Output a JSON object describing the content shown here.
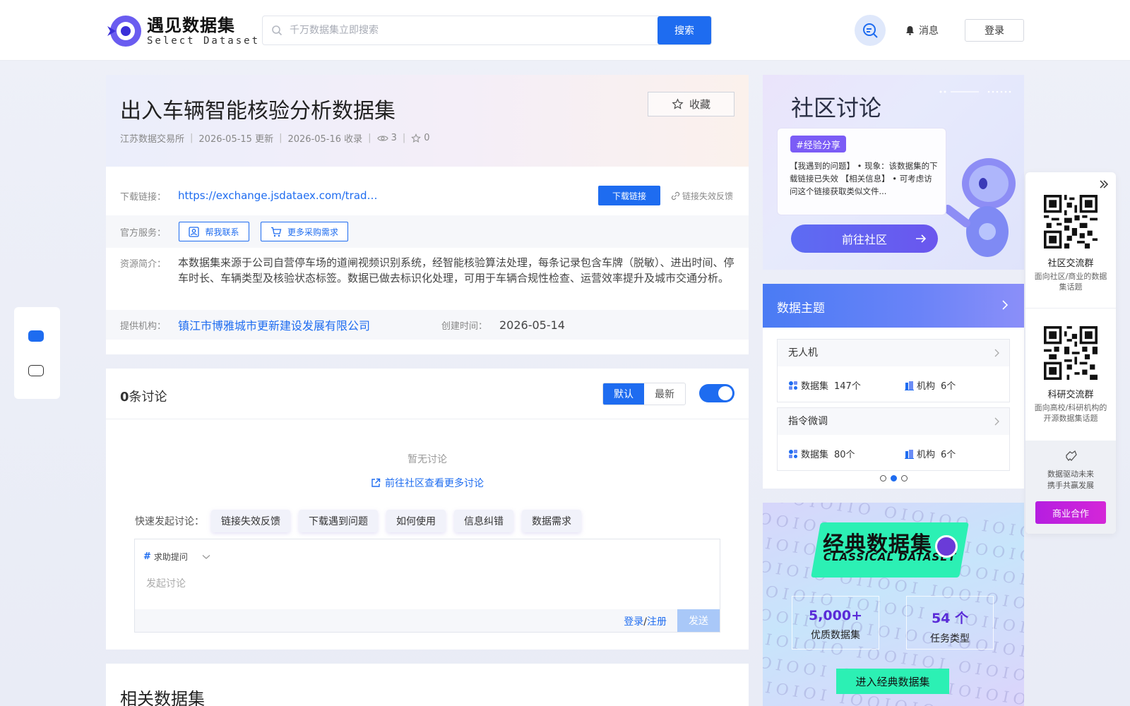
{
  "header": {
    "logo_cn": "遇见数据集",
    "logo_en": "Select Dataset",
    "search_placeholder": "千万数据集立即搜索",
    "search_button": "搜索",
    "messages": "消息",
    "login": "登录"
  },
  "dataset": {
    "title": "出入车辆智能核验分析数据集",
    "favorite_label": "收藏",
    "source": "江苏数据交易所",
    "updated": "2026-05-15 更新",
    "collected": "2026-05-16 收录",
    "views": "3",
    "favorites": "0",
    "download_label": "下载链接：",
    "download_url": "https://exchange.jsdataex.com/trade-…",
    "download_button": "下载链接",
    "link_feedback": "链接失效反馈",
    "service_label": "官方服务：",
    "service_contact": "帮我联系",
    "service_purchase": "更多采购需求",
    "intro_label": "资源简介：",
    "intro_text": "本数据集来源于公司自营停车场的道闸视频识别系统，经智能核验算法处理，每条记录包含车牌（脱敏）、进出时间、停车时长、车辆类型及核验状态标签。数据已做去标识化处理，可用于车辆合规性检查、运营效率提升及城市交通分析。",
    "provider_label": "提供机构：",
    "provider": "镇江市博雅城市更新建设发展有限公司",
    "created_label": "创建时间：",
    "created": "2026-05-14"
  },
  "discussion": {
    "count": "0",
    "count_suffix": "条讨论",
    "sort_default": "默认",
    "sort_latest": "最新",
    "toggle_on": true,
    "empty": "暂无讨论",
    "goto_community": "前往社区查看更多讨论",
    "quick_label": "快速发起讨论：",
    "quick_chips": [
      "链接失效反馈",
      "下载遇到问题",
      "如何使用",
      "信息纠错",
      "数据需求"
    ],
    "editor_tag": "求助提问",
    "editor_placeholder": "发起讨论",
    "login": "登录",
    "slash": "/",
    "register": "注册",
    "send": "发送"
  },
  "related": {
    "title": "相关数据集"
  },
  "community": {
    "title": "社区讨论",
    "tag": "#经验分享",
    "text": "【我遇到的问题】 • 现象：该数据集的下载链接已失效 【相关信息】 • 可考虑访问这个链接获取类似文件...",
    "button": "前往社区"
  },
  "themes": {
    "title": "数据主题",
    "dataset_label": "数据集",
    "org_label": "机构",
    "items": [
      {
        "name": "无人机",
        "datasets": "147个",
        "orgs": "6个"
      },
      {
        "name": "指令微调",
        "datasets": "80个",
        "orgs": "6个"
      }
    ],
    "page": 2,
    "pages": 3
  },
  "classic": {
    "title_cn": "经典数据集",
    "title_en": "CLASSICAL DATASET",
    "stat1_num": "5,000+",
    "stat1_label": "优质数据集",
    "stat2_num": "54 个",
    "stat2_label": "任务类型",
    "button": "进入经典数据集"
  },
  "side_panel": {
    "group1_title": "社区交流群",
    "group1_desc": "面向社区/商业的数据集话题",
    "group2_title": "科研交流群",
    "group2_desc": "面向高校/科研机构的开源数据集话题",
    "slogan_1": "数据驱动未来",
    "slogan_2": "携手共赢发展",
    "business_button": "商业合作"
  },
  "colors": {
    "primary": "#1e6cf0",
    "accent_purple": "#7b5cf6",
    "mint": "#2cf0b4",
    "business": "#c522dc"
  }
}
